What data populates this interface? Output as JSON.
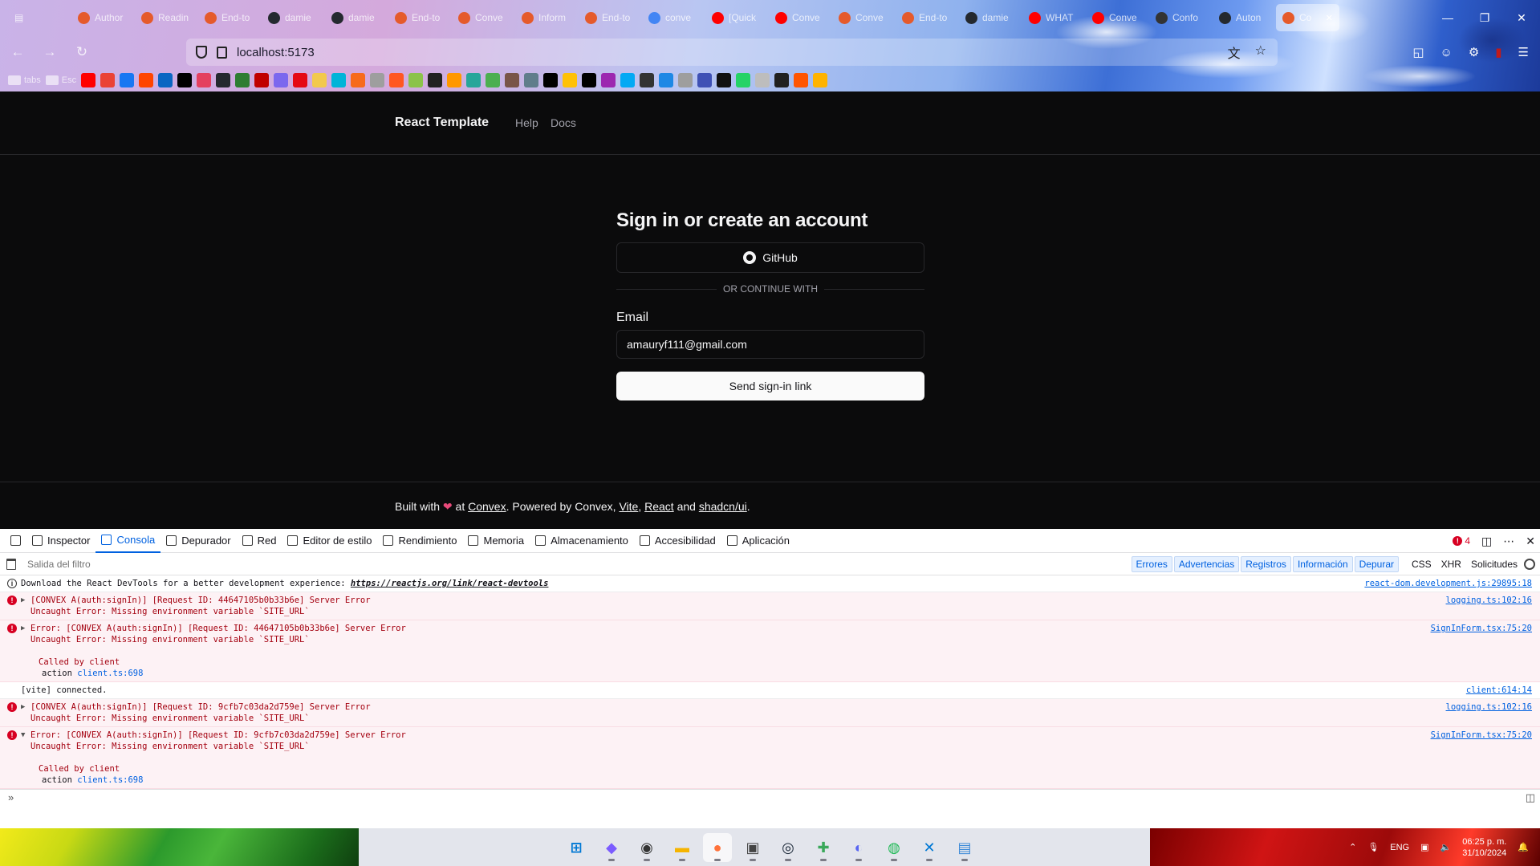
{
  "browser": {
    "tabs": [
      {
        "label": "Author",
        "color": "#e55a2b"
      },
      {
        "label": "Readin",
        "color": "#e55a2b"
      },
      {
        "label": "End-to",
        "color": "#e55a2b"
      },
      {
        "label": "damie",
        "color": "#24292f"
      },
      {
        "label": "damie",
        "color": "#24292f"
      },
      {
        "label": "End-to",
        "color": "#e55a2b"
      },
      {
        "label": "Conve",
        "color": "#e55a2b"
      },
      {
        "label": "Inform",
        "color": "#e55a2b"
      },
      {
        "label": "End-to",
        "color": "#e55a2b"
      },
      {
        "label": "conve",
        "color": "#4285f4"
      },
      {
        "label": "[Quick",
        "color": "#ff0000"
      },
      {
        "label": "Conve",
        "color": "#ff0000"
      },
      {
        "label": "Conve",
        "color": "#e55a2b"
      },
      {
        "label": "End-to",
        "color": "#e55a2b"
      },
      {
        "label": "damie",
        "color": "#24292f"
      },
      {
        "label": "WHAT",
        "color": "#ff0000"
      },
      {
        "label": "Conve",
        "color": "#ff0000"
      },
      {
        "label": "Confo",
        "color": "#333333"
      },
      {
        "label": "Auton",
        "color": "#24292f"
      },
      {
        "label": "Co",
        "color": "#e55a2b",
        "active": true
      }
    ],
    "url": "localhost:5173",
    "bookmarks": {
      "folders": [
        "tabs",
        "Esc"
      ],
      "icon_colors": [
        "#ff0000",
        "#ea4335",
        "#1877f2",
        "#ff4500",
        "#0a66c2",
        "#000000",
        "#e4405f",
        "#24292f",
        "#2e7d32",
        "#c00000",
        "#7b68ee",
        "#e50914",
        "#f2c94c",
        "#00b4d8",
        "#f76b1c",
        "#9e9e9e",
        "#ff5722",
        "#8bc34a",
        "#212121",
        "#ff9800",
        "#26a69a",
        "#4caf50",
        "#795548",
        "#607d8b",
        "#000000",
        "#ffc107",
        "#000000",
        "#9c27b0",
        "#03a9f4",
        "#333333",
        "#1e88e5",
        "#9e9e9e",
        "#3f51b5",
        "#111111",
        "#25d366",
        "#bdbdbd",
        "#212121",
        "#ff5500",
        "#ffb300"
      ]
    }
  },
  "app": {
    "brand": "React Template",
    "nav": {
      "help": "Help",
      "docs": "Docs"
    },
    "signin": {
      "title": "Sign in or create an account",
      "github_label": "GitHub",
      "divider": "OR CONTINUE WITH",
      "email_label": "Email",
      "email_value": "amauryf111@gmail.com",
      "submit_label": "Send sign-in link"
    },
    "footer": {
      "built_with": "Built with",
      "at": "at",
      "convex_link": "Convex",
      "powered": ". Powered by Convex,",
      "vite": "Vite",
      "react": "React",
      "and": "and",
      "shadcn": "shadcn/ui",
      "end": "."
    }
  },
  "devtools": {
    "tabs": [
      {
        "label": "Inspector"
      },
      {
        "label": "Consola",
        "active": true
      },
      {
        "label": "Depurador"
      },
      {
        "label": "Red"
      },
      {
        "label": "Editor de estilo"
      },
      {
        "label": "Rendimiento"
      },
      {
        "label": "Memoria"
      },
      {
        "label": "Almacenamiento"
      },
      {
        "label": "Accesibilidad"
      },
      {
        "label": "Aplicación"
      }
    ],
    "error_count": "4",
    "filter_placeholder": "Salida del filtro",
    "levels": [
      "Errores",
      "Advertencias",
      "Registros",
      "Información",
      "Depurar"
    ],
    "request_filters": [
      "CSS",
      "XHR",
      "Solicitudes"
    ],
    "messages": [
      {
        "type": "info",
        "text": "Download the React DevTools for a better development experience: ",
        "link": "https://reactjs.org/link/react-devtools",
        "source": "react-dom.development.js:29895:18"
      },
      {
        "type": "err",
        "line1": "[CONVEX A(auth:signIn)] [Request ID: 44647105b0b33b6e] Server Error",
        "line2": "Uncaught Error: Missing environment variable `SITE_URL`",
        "source": "logging.ts:102:16"
      },
      {
        "type": "err",
        "line1": "Error: [CONVEX A(auth:signIn)] [Request ID: 44647105b0b33b6e] Server Error",
        "line2": "Uncaught Error: Missing environment variable `SITE_URL`",
        "called": "Called by client",
        "action": "action",
        "action_src": "client.ts:698",
        "source": "SignInForm.tsx:75:20"
      },
      {
        "type": "log",
        "text": "[vite] connected.",
        "source": "client:614:14"
      },
      {
        "type": "err",
        "line1": "[CONVEX A(auth:signIn)] [Request ID: 9cfb7c03da2d759e] Server Error",
        "line2": "Uncaught Error: Missing environment variable `SITE_URL`",
        "source": "logging.ts:102:16"
      },
      {
        "type": "err",
        "line1": "Error: [CONVEX A(auth:signIn)] [Request ID: 9cfb7c03da2d759e] Server Error",
        "line2": "Uncaught Error: Missing environment variable `SITE_URL`",
        "called": "Called by client",
        "action": "action",
        "action_src": "client.ts:698",
        "source": "SignInForm.tsx:75:20"
      }
    ]
  },
  "taskbar": {
    "apps": [
      {
        "name": "start",
        "glyph": "⊞",
        "color": "#0078d4"
      },
      {
        "name": "copilot",
        "glyph": "◆",
        "color": "#7b5cff"
      },
      {
        "name": "obs",
        "glyph": "◉",
        "color": "#333333"
      },
      {
        "name": "files",
        "glyph": "▬",
        "color": "#f5b400"
      },
      {
        "name": "firefox",
        "glyph": "●",
        "color": "#ff7139",
        "active": true
      },
      {
        "name": "minecraft",
        "glyph": "▣",
        "color": "#444444"
      },
      {
        "name": "steam",
        "glyph": "◎",
        "color": "#1b2838"
      },
      {
        "name": "app",
        "glyph": "✚",
        "color": "#3aa85a"
      },
      {
        "name": "discord",
        "glyph": "◐",
        "color": "#5865f2"
      },
      {
        "name": "spotify",
        "glyph": "◍",
        "color": "#1db954"
      },
      {
        "name": "vscode",
        "glyph": "✕",
        "color": "#0078d4"
      },
      {
        "name": "notepad",
        "glyph": "▤",
        "color": "#3c8ad8"
      }
    ],
    "lang": "ENG",
    "time": "06:25 p. m.",
    "date": "31/10/2024"
  }
}
